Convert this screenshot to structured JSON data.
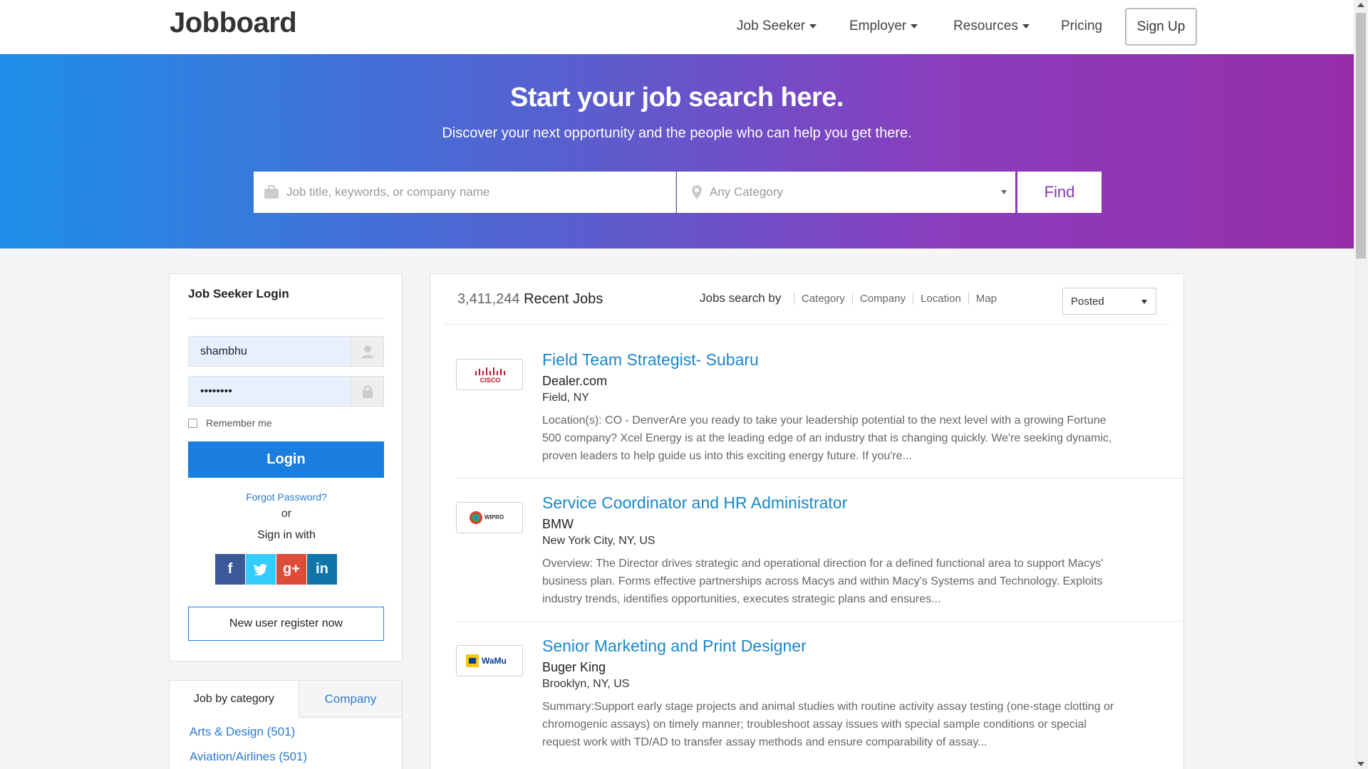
{
  "header": {
    "logo": "Jobboard",
    "nav": [
      {
        "label": "Job Seeker",
        "dropdown": true
      },
      {
        "label": "Employer",
        "dropdown": true
      },
      {
        "label": "Resources",
        "dropdown": true
      },
      {
        "label": "Pricing",
        "dropdown": false
      }
    ],
    "signup_label": "Sign Up"
  },
  "hero": {
    "title": "Start your job search here.",
    "subtitle": "Discover your next opportunity and the people who can help you get there.",
    "keyword_placeholder": "Job title, keywords, or company name",
    "category_value": "Any Category",
    "find_label": "Find"
  },
  "login": {
    "title": "Job Seeker Login",
    "username": "shambhu",
    "password": "••••••••",
    "remember_label": "Remember me",
    "login_label": "Login",
    "forgot_label": "Forgot Password?",
    "or_label": "or",
    "signin_with_label": "Sign in with",
    "socials": [
      {
        "name": "facebook",
        "glyph": "f",
        "color": "#3b5998"
      },
      {
        "name": "twitter",
        "glyph": "t",
        "color": "#33ccff"
      },
      {
        "name": "google-plus",
        "glyph": "g+",
        "color": "#dd4b39"
      },
      {
        "name": "linkedin",
        "glyph": "in",
        "color": "#0e76a8"
      }
    ],
    "register_label": "New user register now"
  },
  "categories": {
    "tabs": [
      "Job by category",
      "Company"
    ],
    "items": [
      "Arts & Design (501)",
      "Aviation/Airlines (501)"
    ]
  },
  "jobs": {
    "count": "3,411,244",
    "count_label": "Recent Jobs",
    "search_by_label": "Jobs search by",
    "filters": [
      "Category",
      "Company",
      "Location",
      "Map"
    ],
    "sort_value": "Posted",
    "list": [
      {
        "logo": "CISCO",
        "title": "Field Team Strategist- Subaru",
        "company": "Dealer.com",
        "location": "Field, NY",
        "description": "Location(s): CO - DenverAre you ready to take your leadership potential to the next level with a growing Fortune 500 company? Xcel Energy is at the leading edge of an industry that is changing quickly. We're seeking dynamic, proven leaders to help guide us into this exciting energy future. If you're..."
      },
      {
        "logo": "WIPRO",
        "title": "Service Coordinator and HR Administrator",
        "company": "BMW",
        "location": "New York City, NY, US",
        "description": "Overview: The Director drives strategic and operational direction for a defined functional area to support Macys' business plan. Forms effective partnerships across Macys and within Macy's Systems and Technology. Exploits industry trends, identifies opportunities, executes strategic plans and ensures..."
      },
      {
        "logo": "WaMu",
        "title": "Senior Marketing and Print Designer",
        "company": "Buger King",
        "location": "Brooklyn, NY, US",
        "description": "Summary:Support early stage projects and animal studies with routine activity assay testing (one-stage clotting or chromogenic assays) on timely manner; troubleshoot assay issues with special sample conditions or special request work with TD/AD to transfer assay methods and ensure comparability of assay..."
      }
    ]
  },
  "colors": {
    "primary": "#1a7de0",
    "link": "#1a87c9",
    "hero_start": "#1d8fe8",
    "hero_end": "#962ea8"
  }
}
